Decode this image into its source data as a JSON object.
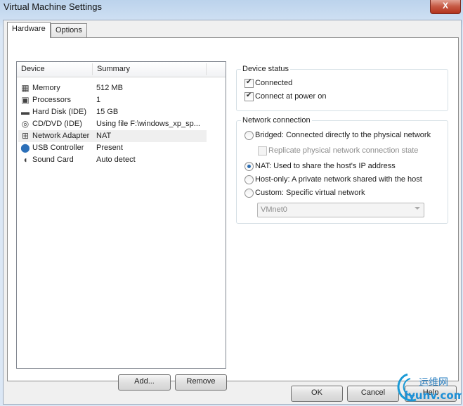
{
  "window": {
    "title": "Virtual Machine Settings",
    "close_label": "X"
  },
  "tabs": [
    {
      "label": "Hardware"
    },
    {
      "label": "Options"
    }
  ],
  "device_list": {
    "columns": [
      "Device",
      "Summary"
    ],
    "rows": [
      {
        "icon": "memory-icon",
        "device": "Memory",
        "summary": "512 MB"
      },
      {
        "icon": "processor-icon",
        "device": "Processors",
        "summary": "1"
      },
      {
        "icon": "hard-disk-icon",
        "device": "Hard Disk (IDE)",
        "summary": "15 GB"
      },
      {
        "icon": "cd-dvd-icon",
        "device": "CD/DVD (IDE)",
        "summary": "Using file F:\\windows_xp_sp..."
      },
      {
        "icon": "network-adapter-icon",
        "device": "Network Adapter",
        "summary": "NAT",
        "selected": true
      },
      {
        "icon": "usb-icon",
        "device": "USB Controller",
        "summary": "Present"
      },
      {
        "icon": "sound-icon",
        "device": "Sound Card",
        "summary": "Auto detect"
      }
    ],
    "add_label": "Add...",
    "remove_label": "Remove"
  },
  "device_status": {
    "legend": "Device status",
    "connected": {
      "label": "Connected",
      "checked": true
    },
    "connect_power_on": {
      "label": "Connect at power on",
      "checked": true
    }
  },
  "network_connection": {
    "legend": "Network connection",
    "bridged": "Bridged: Connected directly to the physical network",
    "replicate": "Replicate physical network connection state",
    "nat": "NAT: Used to share the host's IP address",
    "host_only": "Host-only: A private network shared with the host",
    "custom": "Custom: Specific virtual network",
    "vmnet_value": "VMnet0",
    "selected": "nat"
  },
  "footer": {
    "ok": "OK",
    "cancel": "Cancel",
    "help": "Help"
  },
  "watermark": {
    "text": "运维网",
    "url": "iyunv.com"
  }
}
